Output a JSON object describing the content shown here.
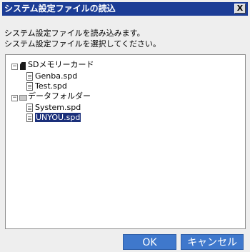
{
  "window": {
    "title": "システム設定ファイルの読込",
    "close_label": "X"
  },
  "message": {
    "line1": "システム設定ファイルを読み込みます。",
    "line2": "システム設定ファイルを選択してください。"
  },
  "tree": {
    "sd_card": {
      "label": "SDメモリーカード",
      "toggle": "−",
      "files": [
        "Genba.spd",
        "Test.spd"
      ]
    },
    "data_folder": {
      "label": "データフォルダー",
      "toggle": "−",
      "files": [
        "System.spd",
        "UNYOU.spd"
      ]
    },
    "selected": "UNYOU.spd"
  },
  "buttons": {
    "ok_label": "OK",
    "cancel_label": "キャンセル"
  },
  "colors": {
    "titlebar": "#1c3d96",
    "selection": "#1a2f7a",
    "button": "#3f78cc"
  }
}
